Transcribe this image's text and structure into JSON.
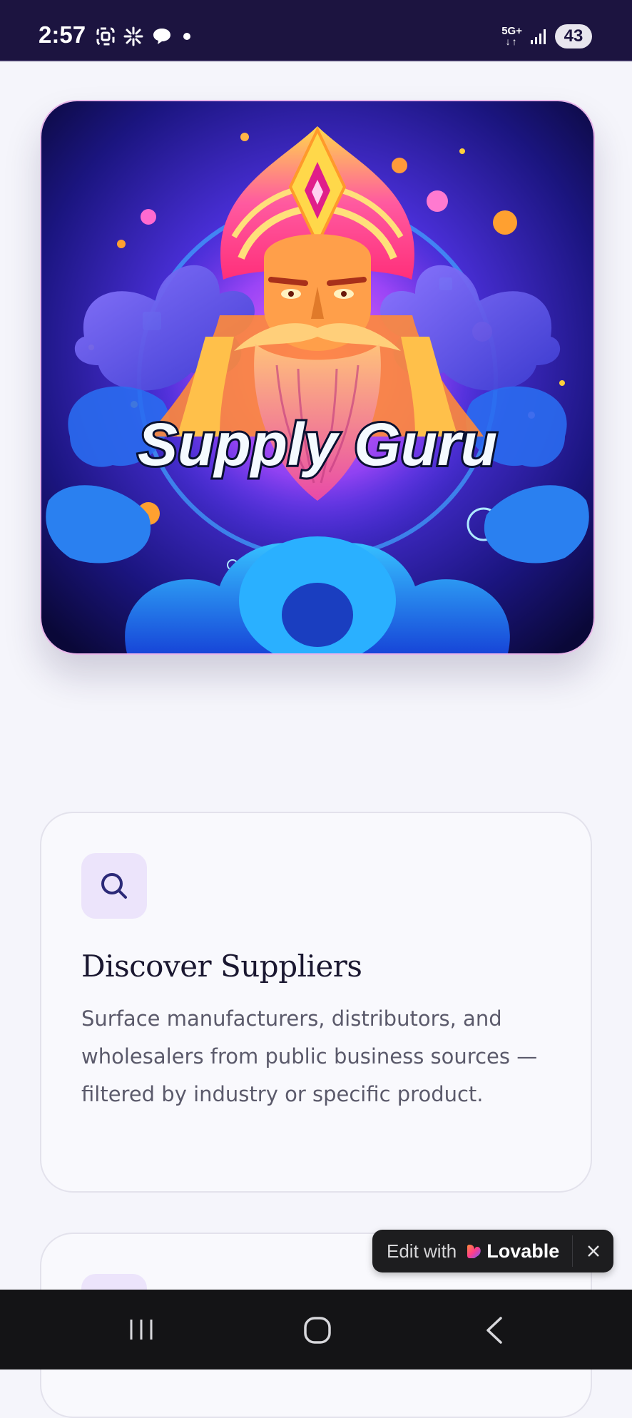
{
  "status_bar": {
    "time": "2:57",
    "network": "5G+",
    "battery": "43",
    "icons": [
      "screenshot-icon",
      "pinwheel-icon",
      "chat-bubble-icon",
      "dot-icon",
      "signal-icon"
    ]
  },
  "hero": {
    "brand_text": "Supply Guru",
    "colors": {
      "sky": "#2a1a8a",
      "glow": "#ff5bd6",
      "cloud": "#1aa8ff",
      "turban": "#ff3d8b",
      "gold": "#ffcf3a"
    }
  },
  "features": [
    {
      "icon": "search-icon",
      "title": "Discover Suppliers",
      "description": "Surface manufacturers, distributors, and wholesalers from public business sources — filtered by industry or specific product."
    }
  ],
  "lovable_badge": {
    "edit_label": "Edit with",
    "brand": "Lovable",
    "close_icon": "close-icon"
  },
  "nav_bar": {
    "buttons": [
      "recent-apps-icon",
      "home-icon",
      "back-icon"
    ]
  }
}
